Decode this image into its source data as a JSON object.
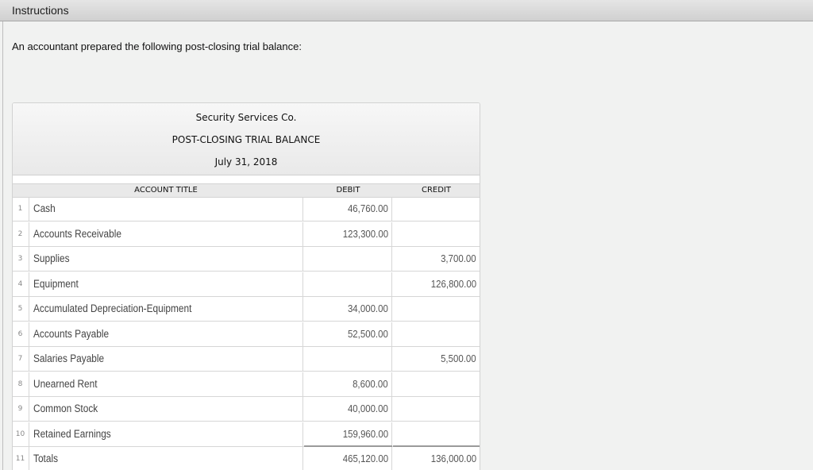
{
  "header": {
    "title": "Instructions"
  },
  "intro": "An accountant prepared the following post-closing trial balance:",
  "report": {
    "company": "Security Services Co.",
    "name": "POST-CLOSING TRIAL BALANCE",
    "date": "July 31, 2018",
    "columns": {
      "account": "ACCOUNT TITLE",
      "debit": "DEBIT",
      "credit": "CREDIT"
    },
    "rows": [
      {
        "num": "1",
        "account": "Cash",
        "debit": "46,760.00",
        "credit": ""
      },
      {
        "num": "2",
        "account": "Accounts Receivable",
        "debit": "123,300.00",
        "credit": ""
      },
      {
        "num": "3",
        "account": "Supplies",
        "debit": "",
        "credit": "3,700.00"
      },
      {
        "num": "4",
        "account": "Equipment",
        "debit": "",
        "credit": "126,800.00"
      },
      {
        "num": "5",
        "account": "Accumulated Depreciation-Equipment",
        "debit": "34,000.00",
        "credit": ""
      },
      {
        "num": "6",
        "account": "Accounts Payable",
        "debit": "52,500.00",
        "credit": ""
      },
      {
        "num": "7",
        "account": "Salaries Payable",
        "debit": "",
        "credit": "5,500.00"
      },
      {
        "num": "8",
        "account": "Unearned Rent",
        "debit": "8,600.00",
        "credit": ""
      },
      {
        "num": "9",
        "account": "Common Stock",
        "debit": "40,000.00",
        "credit": ""
      },
      {
        "num": "10",
        "account": "Retained Earnings",
        "debit": "159,960.00",
        "credit": ""
      },
      {
        "num": "11",
        "account": "Totals",
        "debit": "465,120.00",
        "credit": "136,000.00"
      }
    ]
  }
}
